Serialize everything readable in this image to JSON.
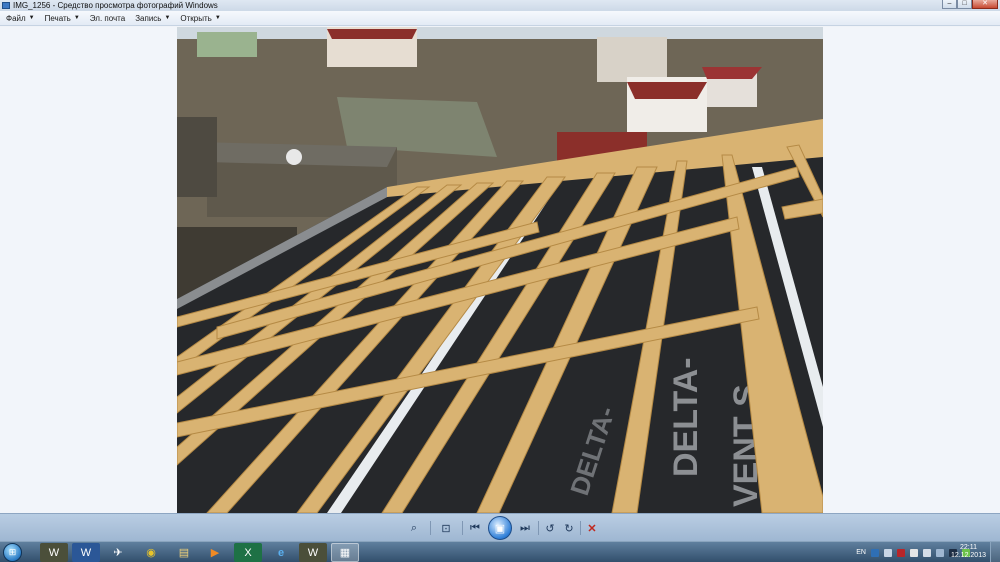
{
  "window": {
    "title": "IMG_1256 - Средство просмотра фотографий Windows",
    "minimize_glyph": "–",
    "maximize_glyph": "□",
    "close_glyph": "✕"
  },
  "menu": {
    "items": [
      {
        "label": "Файл",
        "dropdown": true
      },
      {
        "label": "Печать",
        "dropdown": true
      },
      {
        "label": "Эл. почта",
        "dropdown": false
      },
      {
        "label": "Запись",
        "dropdown": true
      },
      {
        "label": "Открыть",
        "dropdown": true
      }
    ]
  },
  "photo": {
    "membrane_text_1": "DELTA-",
    "membrane_text_2": "VENT S",
    "colors": {
      "sky": "#cfd8df",
      "membrane": "#26282b",
      "wood": "#d9b372",
      "wood_dark": "#b58a45",
      "roof_red": "#8b2f2a",
      "village": "#6b6153"
    }
  },
  "controls": {
    "zoom_icon": "⌕",
    "fit_icon": "⊡",
    "prev_icon": "⏮",
    "play_icon": "▣",
    "next_icon": "⏭",
    "rotate_ccw_icon": "↺",
    "rotate_cw_icon": "↻",
    "delete_icon": "✕"
  },
  "taskbar": {
    "start_icon": "⊞",
    "apps": [
      {
        "name": "world-of-tanks",
        "glyph": "W"
      },
      {
        "name": "word",
        "glyph": "W"
      },
      {
        "name": "aircraft-app",
        "glyph": "✈"
      },
      {
        "name": "chrome",
        "glyph": "◉"
      },
      {
        "name": "explorer",
        "glyph": "▤"
      },
      {
        "name": "media-player",
        "glyph": "▶"
      },
      {
        "name": "excel",
        "glyph": "X"
      },
      {
        "name": "internet-explorer",
        "glyph": "e"
      },
      {
        "name": "world-of-tanks-2",
        "glyph": "W"
      },
      {
        "name": "photo-viewer",
        "glyph": "▦"
      }
    ],
    "language": "EN",
    "clock_time": "22:11",
    "clock_date": "12.12.2013"
  }
}
